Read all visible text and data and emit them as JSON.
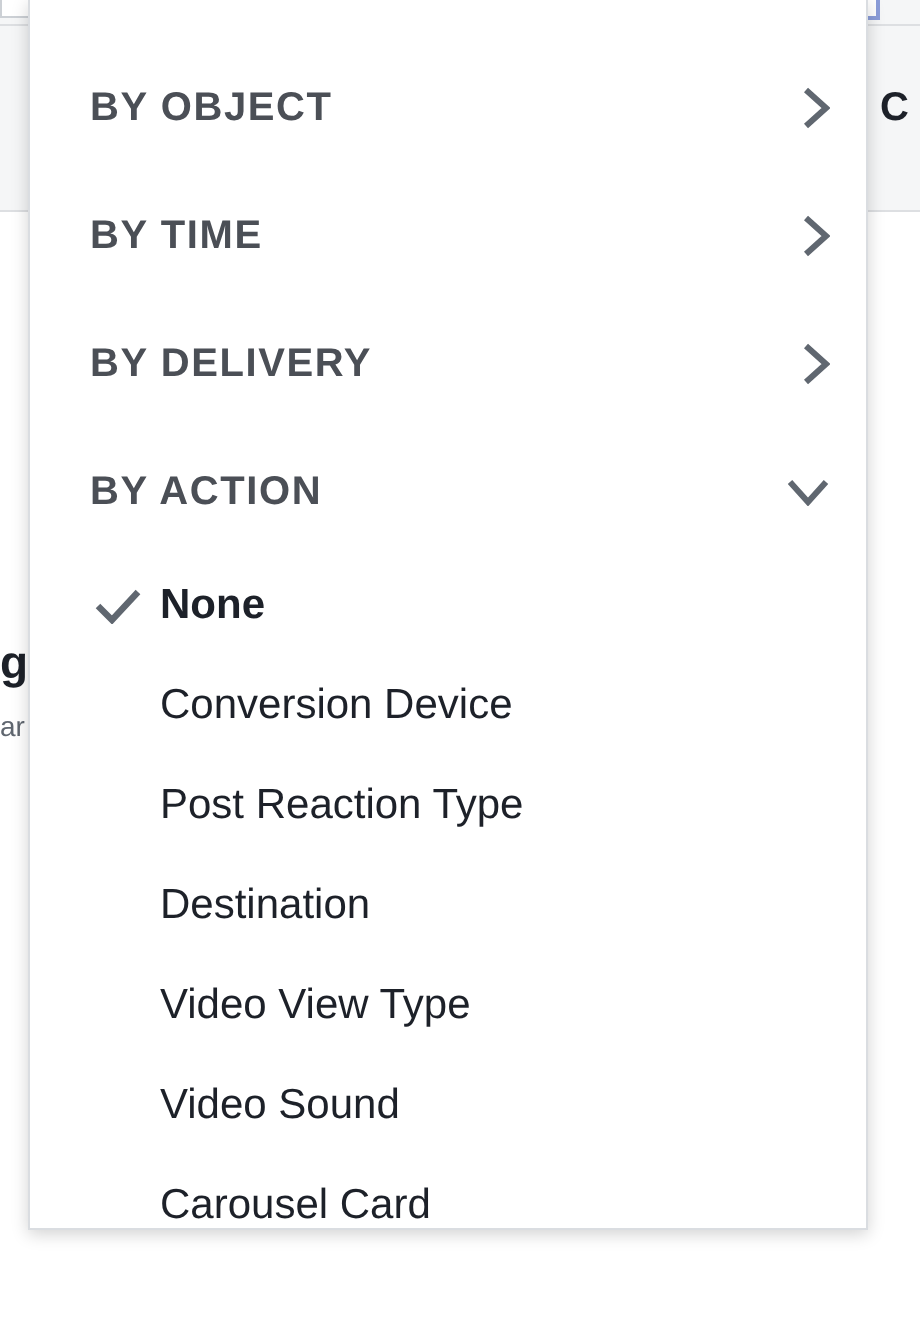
{
  "background": {
    "right_fragment": "C",
    "left_fragments": [
      "g",
      "ar"
    ]
  },
  "menu": {
    "groups": [
      {
        "label": "BY OBJECT",
        "expanded": false
      },
      {
        "label": "BY TIME",
        "expanded": false
      },
      {
        "label": "BY DELIVERY",
        "expanded": false
      },
      {
        "label": "BY ACTION",
        "expanded": true,
        "options": [
          {
            "label": "None",
            "selected": true
          },
          {
            "label": "Conversion Device",
            "selected": false
          },
          {
            "label": "Post Reaction Type",
            "selected": false
          },
          {
            "label": "Destination",
            "selected": false
          },
          {
            "label": "Video View Type",
            "selected": false
          },
          {
            "label": "Video Sound",
            "selected": false
          },
          {
            "label": "Carousel Card",
            "selected": false
          }
        ]
      }
    ]
  }
}
